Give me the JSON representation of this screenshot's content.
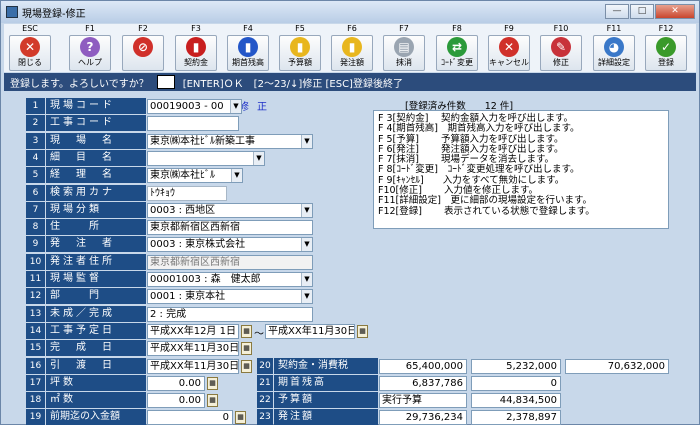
{
  "window": {
    "title": "現場登録-修正"
  },
  "toolbar": [
    {
      "fkey": "ESC",
      "label": "閉じる",
      "icon": "close-window-icon",
      "color": "#d23a2a",
      "glyph": "✕"
    },
    {
      "fkey": "F1",
      "label": "ヘルプ",
      "icon": "help-icon",
      "color": "#8e5cc0",
      "glyph": "?"
    },
    {
      "fkey": "F2",
      "label": "",
      "icon": "prohibited-icon",
      "color": "#d0302a",
      "glyph": "⊘"
    },
    {
      "fkey": "F3",
      "label": "契約金",
      "icon": "red-book-icon",
      "color": "#c81e1e",
      "glyph": "▮"
    },
    {
      "fkey": "F4",
      "label": "期首残高",
      "icon": "blue-book-icon",
      "color": "#2356c8",
      "glyph": "▮"
    },
    {
      "fkey": "F5",
      "label": "予算額",
      "icon": "yellow-folder-icon",
      "color": "#e8b61e",
      "glyph": "▮"
    },
    {
      "fkey": "F6",
      "label": "発注額",
      "icon": "yellow-folder-icon",
      "color": "#e8b61e",
      "glyph": "▮"
    },
    {
      "fkey": "F7",
      "label": "抹消",
      "icon": "delete-doc-icon",
      "color": "#9aa5b1",
      "glyph": "▤"
    },
    {
      "fkey": "F8",
      "label": "ｺｰﾄﾞ変更",
      "icon": "shuffle-icon",
      "color": "#2b9a3a",
      "glyph": "⇄"
    },
    {
      "fkey": "F9",
      "label": "キャンセル",
      "icon": "cancel-icon",
      "color": "#d0302a",
      "glyph": "✕"
    },
    {
      "fkey": "F10",
      "label": "修正",
      "icon": "edit-icon",
      "color": "#c8323a",
      "glyph": "✎"
    },
    {
      "fkey": "F11",
      "label": "詳細設定",
      "icon": "detail-settings-icon",
      "color": "#3a78c8",
      "glyph": "◕"
    },
    {
      "fkey": "F12",
      "label": "登録",
      "icon": "register-check-icon",
      "color": "#3a9a2a",
      "glyph": "✓"
    }
  ],
  "message": {
    "prompt": "登録します。よろしいですか？",
    "input": "",
    "keys": "[ENTER]ＯＫ　[2〜23/↓]修正 [ESC]登録後終了"
  },
  "mode_label": "修正",
  "count_header": "[登録済み件数　　12 件]",
  "help_lines": [
    "F 3[契約金]　 契約金額入力を呼び出します。",
    "F 4[期首残高]　期首残高入力を呼び出します。",
    "F 5[予算]　　 予算額入力を呼び出します。",
    "F 6[発注]　　 発注額入力を呼び出します。",
    "F 7[抹消]　　 現場データを消去します。",
    "F 8[ｺｰﾄﾞ変更]　ｺｰﾄﾞ変更処理を呼び出します。",
    "F 9[ｷｬﾝｾﾙ]　　入力をすべて無効にします。",
    "F10[修正]　　 入力値を修正します。",
    "F11[詳細設定]　更に細部の現場設定を行います。",
    "F12[登録]　　 表示されている状態で登録します。"
  ],
  "fields": [
    {
      "no": "1",
      "label": "現場コード",
      "value": "00019003 - 00"
    },
    {
      "no": "2",
      "label": "工事コード",
      "value": ""
    },
    {
      "no": "3",
      "label": "現　場　名",
      "value": "東京㈱本社ﾋﾞﾙ新築工事"
    },
    {
      "no": "4",
      "label": "細　目　名",
      "value": ""
    },
    {
      "no": "5",
      "label": "経　理　名",
      "value": "東京㈱本社ﾋﾞﾙ"
    },
    {
      "no": "6",
      "label": "検索用カナ",
      "value": "ﾄｳｷｮｳ"
    },
    {
      "no": "7",
      "label": "現場分類",
      "value": "0003 : 西地区"
    },
    {
      "no": "8",
      "label": "住　　所",
      "value": "東京都新宿区西新宿"
    },
    {
      "no": "9",
      "label": "発　注　者",
      "value": "0003 : 東京株式会社"
    },
    {
      "no": "10",
      "label": "発注者住所",
      "value": "東京都新宿区西新宿"
    },
    {
      "no": "11",
      "label": "現場監督",
      "value": "00001003 : 森　健太郎"
    },
    {
      "no": "12",
      "label": "部　　門",
      "value": "0001 : 東京本社"
    },
    {
      "no": "13",
      "label": "未成／完成",
      "value": "2 : 完成"
    },
    {
      "no": "14",
      "label": "工事予定日",
      "value": "平成XX年12月 1日",
      "value2": "平成XX年11月30日",
      "sep": "〜"
    },
    {
      "no": "15",
      "label": "完　成　日",
      "value": "平成XX年11月30日"
    },
    {
      "no": "16",
      "label": "引　渡　日",
      "value": "平成XX年11月30日"
    },
    {
      "no": "17",
      "label": "坪数",
      "value": "0.00"
    },
    {
      "no": "18",
      "label": "㎡数",
      "value": "0.00"
    },
    {
      "no": "19",
      "label": "前期迄の入金額",
      "value": "0"
    }
  ],
  "summary": [
    {
      "no": "20",
      "label": "契約金・消費税",
      "v1": "65,400,000",
      "v2": "5,232,000",
      "v3": "70,632,000"
    },
    {
      "no": "21",
      "label": "期首残高",
      "v1": "6,837,786",
      "v2": "0"
    },
    {
      "no": "22",
      "label": "予算額",
      "v1": "実行予算",
      "v2": "44,834,500"
    },
    {
      "no": "23",
      "label": "発注額",
      "v1": "29,736,234",
      "v2": "2,378,897"
    }
  ]
}
